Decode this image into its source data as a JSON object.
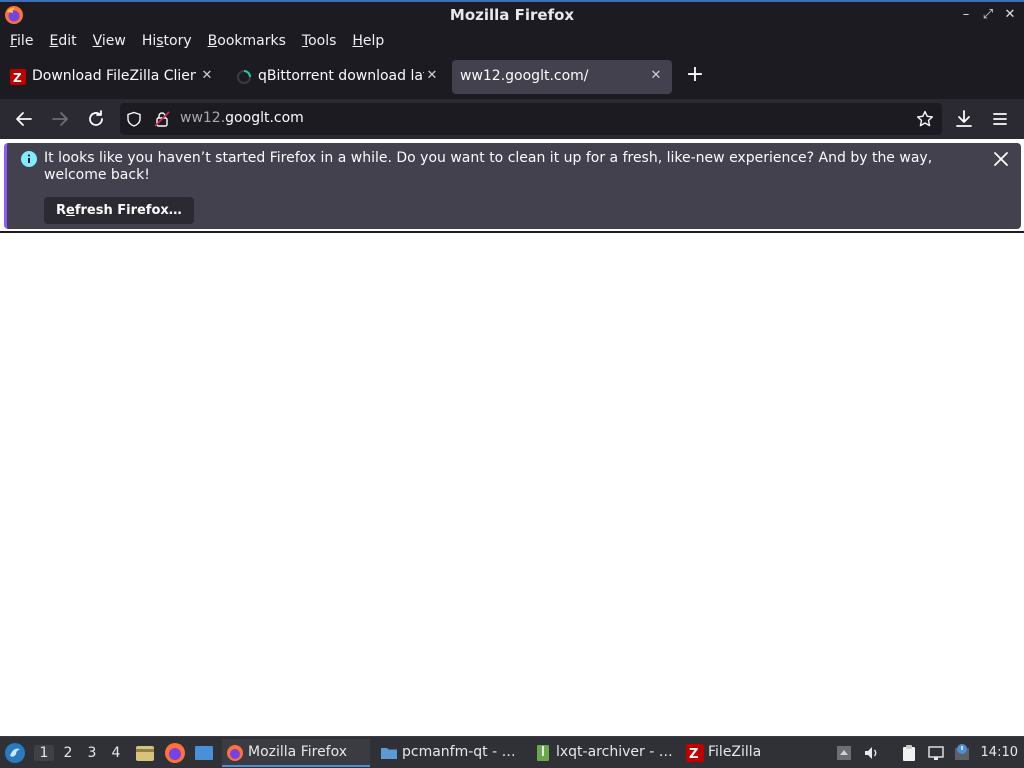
{
  "window": {
    "title": "Mozilla Firefox"
  },
  "menu": {
    "items": [
      {
        "pre": "",
        "u": "F",
        "post": "ile"
      },
      {
        "pre": "",
        "u": "E",
        "post": "dit"
      },
      {
        "pre": "",
        "u": "V",
        "post": "iew"
      },
      {
        "pre": "Hi",
        "u": "s",
        "post": "tory"
      },
      {
        "pre": "",
        "u": "B",
        "post": "ookmarks"
      },
      {
        "pre": "",
        "u": "T",
        "post": "ools"
      },
      {
        "pre": "",
        "u": "H",
        "post": "elp"
      }
    ]
  },
  "tabs": [
    {
      "label": "Download FileZilla Client",
      "favicon": "filezilla-icon"
    },
    {
      "label": "qBittorrent download late",
      "favicon": "loading-spinner-icon"
    },
    {
      "label": "ww12.googlt.com/",
      "favicon": "none"
    }
  ],
  "urlbar": {
    "host": "ww12.googlt.com",
    "prefix": "ww12.",
    "domain": "googlt.com"
  },
  "notification": {
    "message": "It looks like you haven’t started Firefox in a while. Do you want to clean it up for a fresh, like-new experience? And by the way, welcome back!",
    "button_pre": "R",
    "button_u": "e",
    "button_post": "fresh Firefox…"
  },
  "taskbar": {
    "workspaces": [
      "1",
      "2",
      "3",
      "4"
    ],
    "active_workspace": "1",
    "tasks": [
      {
        "label": "Mozilla Firefox",
        "icon": "firefox-icon"
      },
      {
        "label": "pcmanfm-qt - …",
        "icon": "folder-icon"
      },
      {
        "label": "lxqt-archiver - …",
        "icon": "archive-icon"
      },
      {
        "label": "FileZilla",
        "icon": "filezilla-icon"
      }
    ],
    "clock": "14:10"
  },
  "colors": {
    "accent": "#9059ff",
    "toolbar": "#2b2a33",
    "frame": "#1c1b22",
    "info": "#80ebff"
  }
}
